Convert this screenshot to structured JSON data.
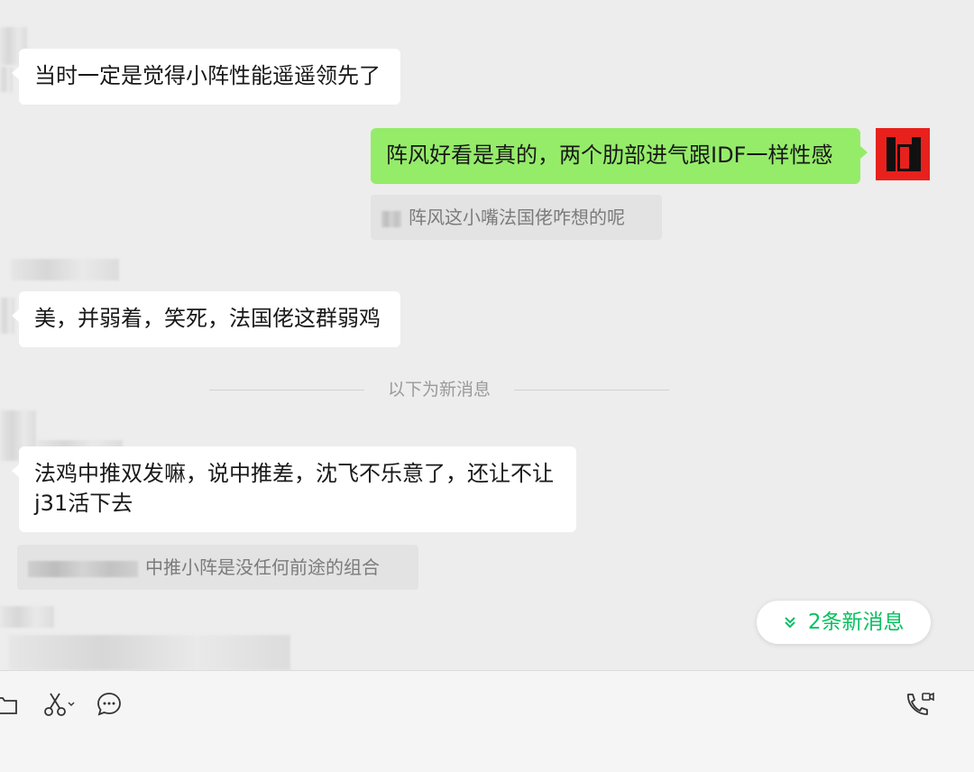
{
  "messages": [
    {
      "id": "m1",
      "text": "当时一定是觉得小阵性能遥遥领先了"
    },
    {
      "id": "m2",
      "text": "阵风好看是真的，两个肋部进气跟IDF一样性感"
    },
    {
      "id": "m3",
      "text": "美，并弱着，笑死，法国佬这群弱鸡"
    },
    {
      "id": "m4",
      "text": "法鸡中推双发嘛，说中推差，沈飞不乐意了，还让不让j31活下去"
    }
  ],
  "quotes": [
    {
      "id": "q1",
      "text": "阵风这小嘴法国佬咋想的呢"
    },
    {
      "id": "q2",
      "text": "中推小阵是没任何前途的组合"
    }
  ],
  "divider_text": "以下为新消息",
  "new_messages_button": {
    "label": "2条新消息",
    "icon": "double-chevron-down-icon"
  },
  "toolbar": {
    "icons": [
      "folder-icon",
      "scissors-icon",
      "chat-bubble-icon",
      "video-call-icon"
    ]
  },
  "colors": {
    "background": "#ededed",
    "outgoing_bubble": "#95ec69",
    "incoming_bubble": "#ffffff",
    "accent": "#07c160"
  }
}
